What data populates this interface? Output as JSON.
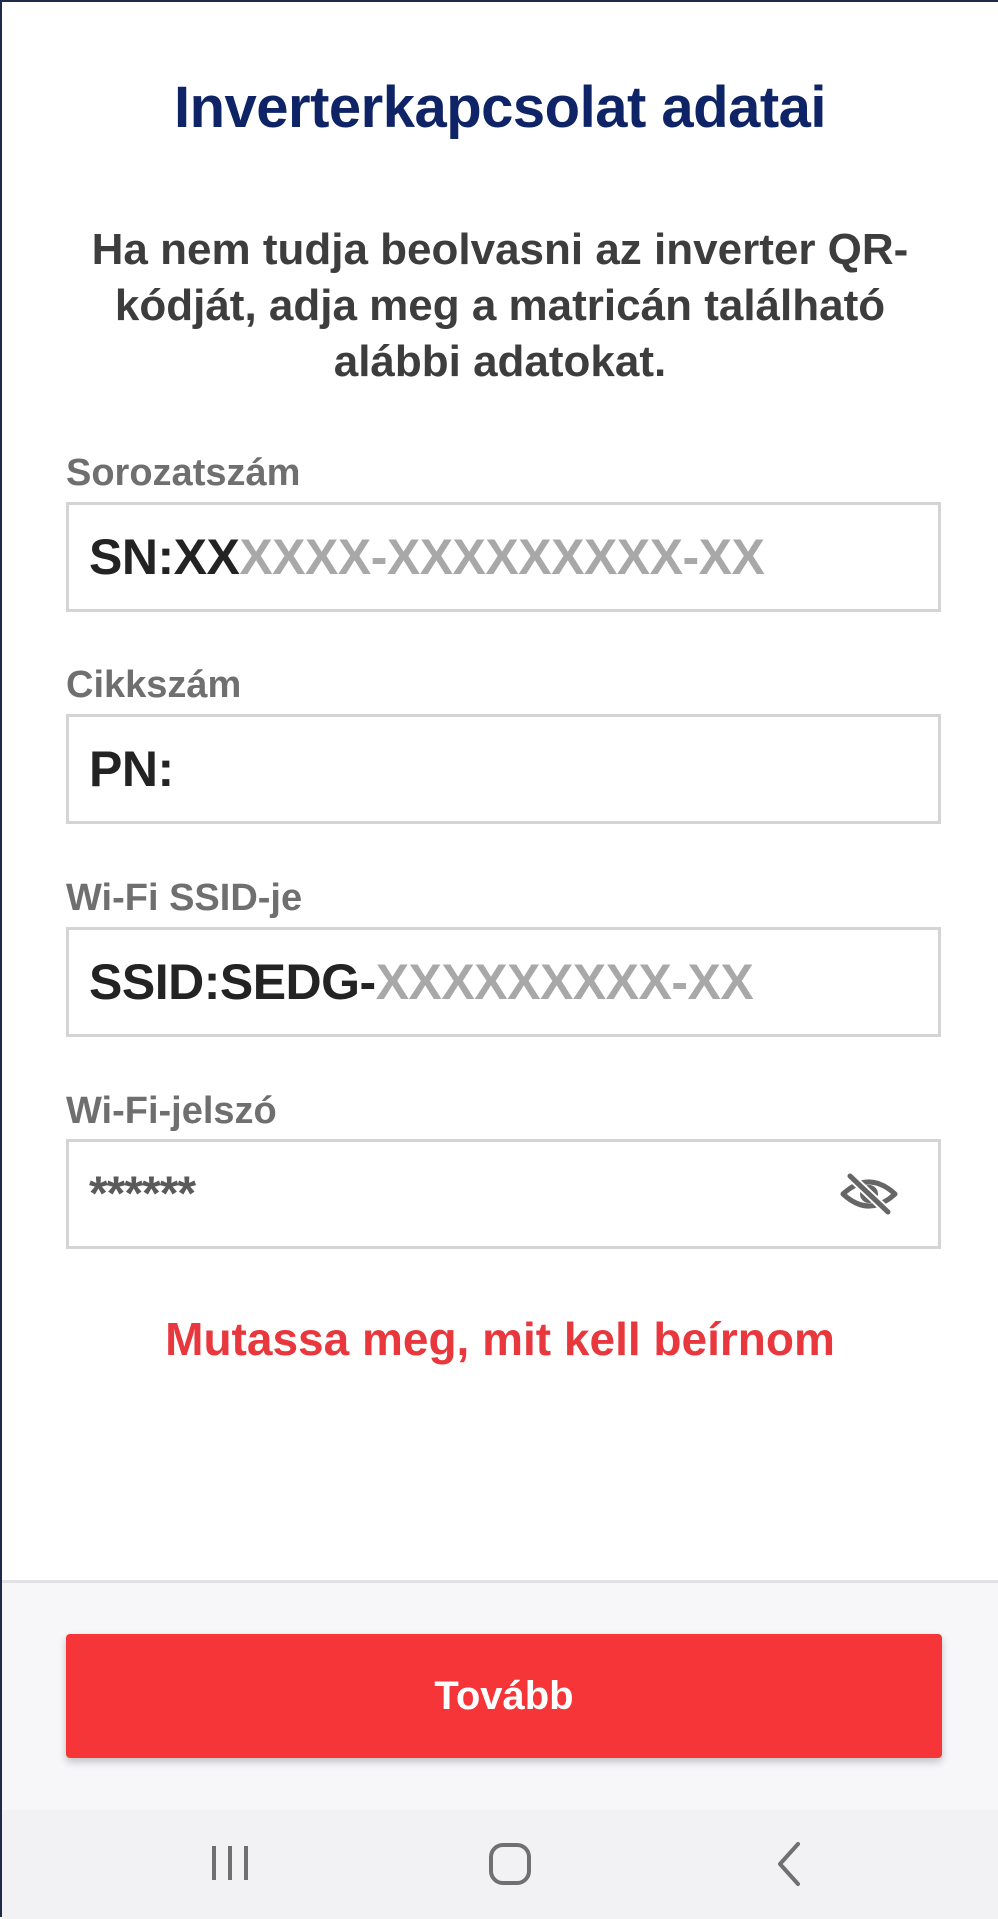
{
  "page": {
    "title": "Inverterkapcsolat adatai",
    "intro": "Ha nem tudja beolvasni az inverter QR-kódját, adja meg a matricán található alábbi adatokat."
  },
  "fields": {
    "serial": {
      "label": "Sorozatszám",
      "value_prefix": "SN:XX",
      "value_placeholder": "XXXX-XXXXXXXXX-XX"
    },
    "part": {
      "label": "Cikkszám",
      "value_prefix": "PN:"
    },
    "ssid": {
      "label": "Wi-Fi SSID-je",
      "value_prefix": "SSID:SEDG-",
      "value_placeholder": "XXXXXXXXX-XX"
    },
    "password": {
      "label": "Wi-Fi-jelszó",
      "value_masked": "******",
      "toggle_icon": "eye-slash-icon"
    }
  },
  "help_link": "Mutassa meg, mit kell beírnom",
  "footer": {
    "next_button": "Tovább"
  },
  "system_nav": {
    "recents_icon": "recents-icon",
    "home_icon": "home-icon",
    "back_icon": "back-icon"
  },
  "colors": {
    "title": "#0e2466",
    "accent": "#f53538",
    "link": "#e8383d",
    "placeholder": "#a8a8a8"
  }
}
